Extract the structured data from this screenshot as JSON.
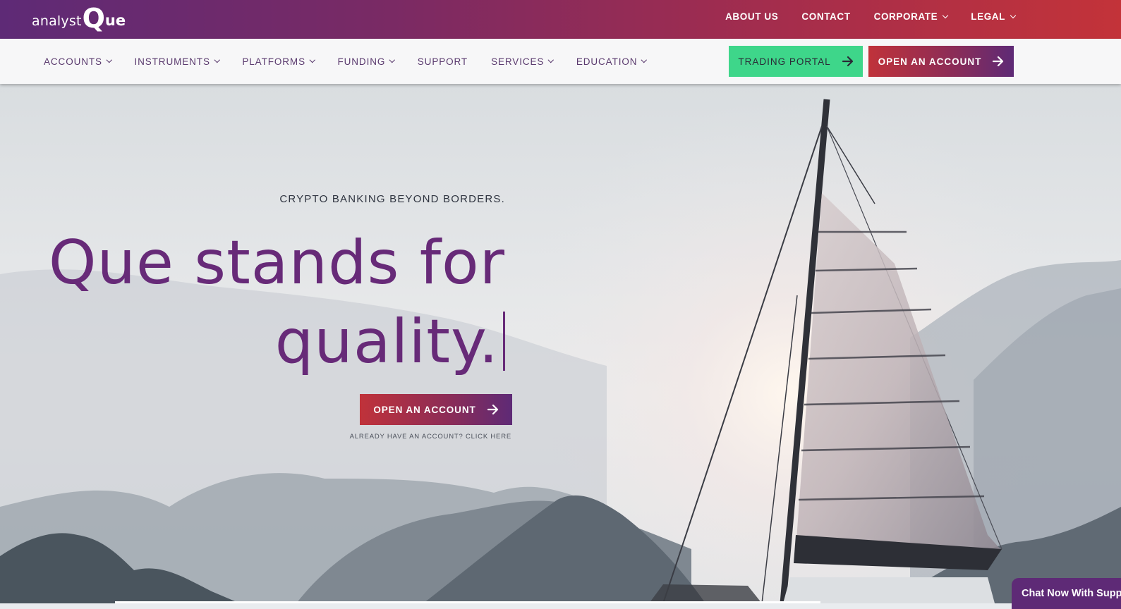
{
  "logo": {
    "part1": "analyst",
    "part2": "Q",
    "part3": "ue"
  },
  "top_links": [
    {
      "label": "ABOUT US",
      "has_dropdown": false
    },
    {
      "label": "CONTACT",
      "has_dropdown": false
    },
    {
      "label": "CORPORATE",
      "has_dropdown": true
    },
    {
      "label": "LEGAL",
      "has_dropdown": true
    }
  ],
  "nav": [
    {
      "label": "ACCOUNTS",
      "has_dropdown": true
    },
    {
      "label": "INSTRUMENTS",
      "has_dropdown": true
    },
    {
      "label": "PLATFORMS",
      "has_dropdown": true
    },
    {
      "label": "FUNDING",
      "has_dropdown": true
    },
    {
      "label": "SUPPORT",
      "has_dropdown": false
    },
    {
      "label": "SERVICES",
      "has_dropdown": true
    },
    {
      "label": "EDUCATION",
      "has_dropdown": true
    }
  ],
  "buttons": {
    "trading_portal": "TRADING PORTAL",
    "open_account": "OPEN AN ACCOUNT"
  },
  "hero": {
    "tagline": "CRYPTO BANKING BEYOND BORDERS.",
    "headline_line1": "Que stands for",
    "headline_line2": "quality.",
    "cta": "OPEN AN ACCOUNT",
    "already": "ALREADY HAVE AN ACCOUNT? CLICK HERE"
  },
  "chat": {
    "label": "Chat Now With Supp"
  },
  "colors": {
    "brand_purple": "#672a78",
    "brand_red": "#c33339",
    "trading_green": "#3ed68a"
  },
  "icons": [
    "chevron-down-icon",
    "arrow-right-icon"
  ]
}
